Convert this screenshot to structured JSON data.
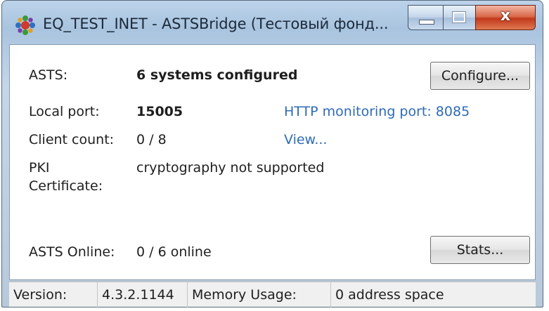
{
  "window": {
    "title": "EQ_TEST_INET - ASTSBridge (Тестовый фонд...",
    "app_icon": "asts-bridge-app-icon",
    "controls": {
      "minimize_icon": "minimize-icon",
      "maximize_icon": "maximize-icon",
      "close_glyph": "x"
    }
  },
  "fields": {
    "asts": {
      "label": "ASTS:",
      "value": "6 systems configured"
    },
    "local_port": {
      "label": "Local port:",
      "value": "15005"
    },
    "client_count": {
      "label": "Client count:",
      "value": "0 / 8"
    },
    "pki": {
      "label_line1": "PKI",
      "label_line2": "Certificate:",
      "value": "cryptography not supported"
    },
    "asts_online": {
      "label": "ASTS Online:",
      "value": "0 / 6 online"
    }
  },
  "links": {
    "http_monitoring": "HTTP monitoring port: 8085",
    "view": "View..."
  },
  "buttons": {
    "configure": "Configure...",
    "stats": "Stats..."
  },
  "statusbar": {
    "version_label": "Version:",
    "version_value": "4.3.2.1144",
    "memory_label": "Memory Usage:",
    "memory_value": "0 address space"
  },
  "colors": {
    "link": "#2e6bb4",
    "close_button": "#c2381c",
    "frame": "#a9c4df"
  }
}
